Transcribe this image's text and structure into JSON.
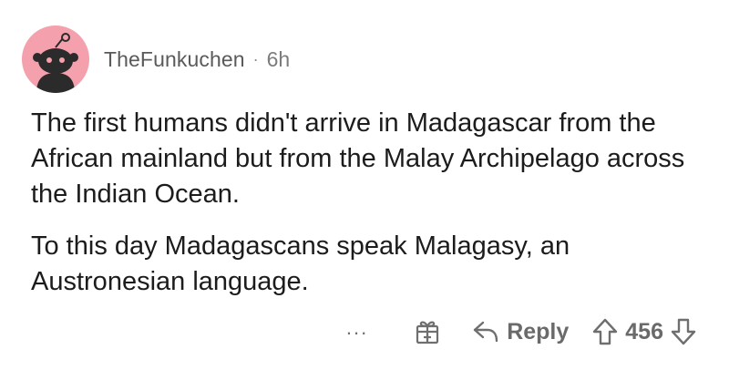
{
  "comment": {
    "author": "TheFunkuchen",
    "separator": "·",
    "age": "6h",
    "paragraphs": [
      "The first humans didn't arrive in Madagascar from the African mainland but from the Malay Archipelago across the Indian Ocean.",
      "To this day Madagascans speak Malagasy, an Austronesian language."
    ]
  },
  "actions": {
    "more_label": "...",
    "reply_label": "Reply",
    "score": "456"
  },
  "icons": {
    "avatar": "reddit-snoo-avatar-icon",
    "more": "more-options-icon",
    "gift": "gift-award-icon",
    "reply": "reply-arrow-icon",
    "upvote": "upvote-arrow-icon",
    "downvote": "downvote-arrow-icon"
  },
  "colors": {
    "avatar_bg": "#f4a0ad",
    "meta_text": "#7c7c7c",
    "body_text": "#1c1c1c"
  }
}
